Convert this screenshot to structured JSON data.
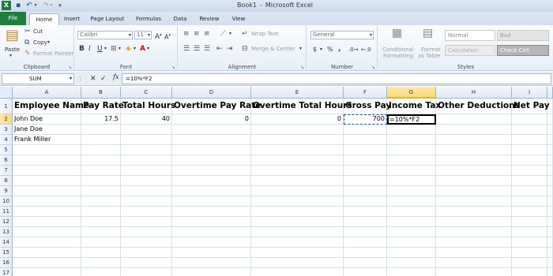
{
  "titlebar": {
    "app_icon": "excel-app-icon",
    "title_workbook": "Book1",
    "title_separator": "-",
    "title_app": "Microsoft Excel"
  },
  "tabs": [
    {
      "label": "File"
    },
    {
      "label": "Home"
    },
    {
      "label": "Insert"
    },
    {
      "label": "Page Layout"
    },
    {
      "label": "Formulas"
    },
    {
      "label": "Data"
    },
    {
      "label": "Review"
    },
    {
      "label": "View"
    }
  ],
  "ribbon": {
    "clipboard": {
      "label": "Clipboard",
      "paste": "Paste",
      "cut": "Cut",
      "copy": "Copy",
      "format_painter": "Format Painter"
    },
    "font": {
      "label": "Font",
      "name": "Calibri",
      "size": "11"
    },
    "alignment": {
      "label": "Alignment",
      "wrap_text": "Wrap Text",
      "merge_center": "Merge & Center"
    },
    "number": {
      "label": "Number",
      "format": "General",
      "currency": "$",
      "percent": "%",
      "comma": ","
    },
    "styles": {
      "label": "Styles",
      "conditional": "Conditional",
      "conditional2": "Formatting",
      "format_as": "Format",
      "format_as2": "as Table",
      "normal": "Normal",
      "bad": "Bad",
      "calculation": "Calculation",
      "check_cell": "Check Cell"
    }
  },
  "formula_bar": {
    "name_box": "SUM",
    "fx": "fx",
    "formula": "=10%*F2"
  },
  "columns": [
    "A",
    "B",
    "C",
    "D",
    "E",
    "F",
    "G",
    "H",
    "I"
  ],
  "rows": [
    "1",
    "2",
    "3",
    "4",
    "5",
    "6",
    "7",
    "8",
    "9",
    "10",
    "11",
    "12",
    "13",
    "14",
    "15",
    "16",
    "17"
  ],
  "headers": [
    "Employee Name",
    "Pay Rate",
    "Total Hours",
    "Overtime Pay Rate",
    "Overtime Total Hours",
    "Gross Pay",
    "Income Tax",
    "Other Deductions",
    "Net Pay"
  ],
  "data_rows": [
    [
      "John Doe",
      "17.5",
      "40",
      "0",
      "0",
      "700",
      "=10%*F2",
      "",
      ""
    ],
    [
      "Jane Doe",
      "",
      "",
      "",
      "",
      "",
      "",
      "",
      ""
    ],
    [
      "Frank Miller",
      "",
      "",
      "",
      "",
      "",
      "",
      "",
      ""
    ]
  ],
  "colors": {
    "file_tab": "#1e7e3e",
    "active_cell_border": "#000000",
    "selected_header": "#f9d878"
  }
}
